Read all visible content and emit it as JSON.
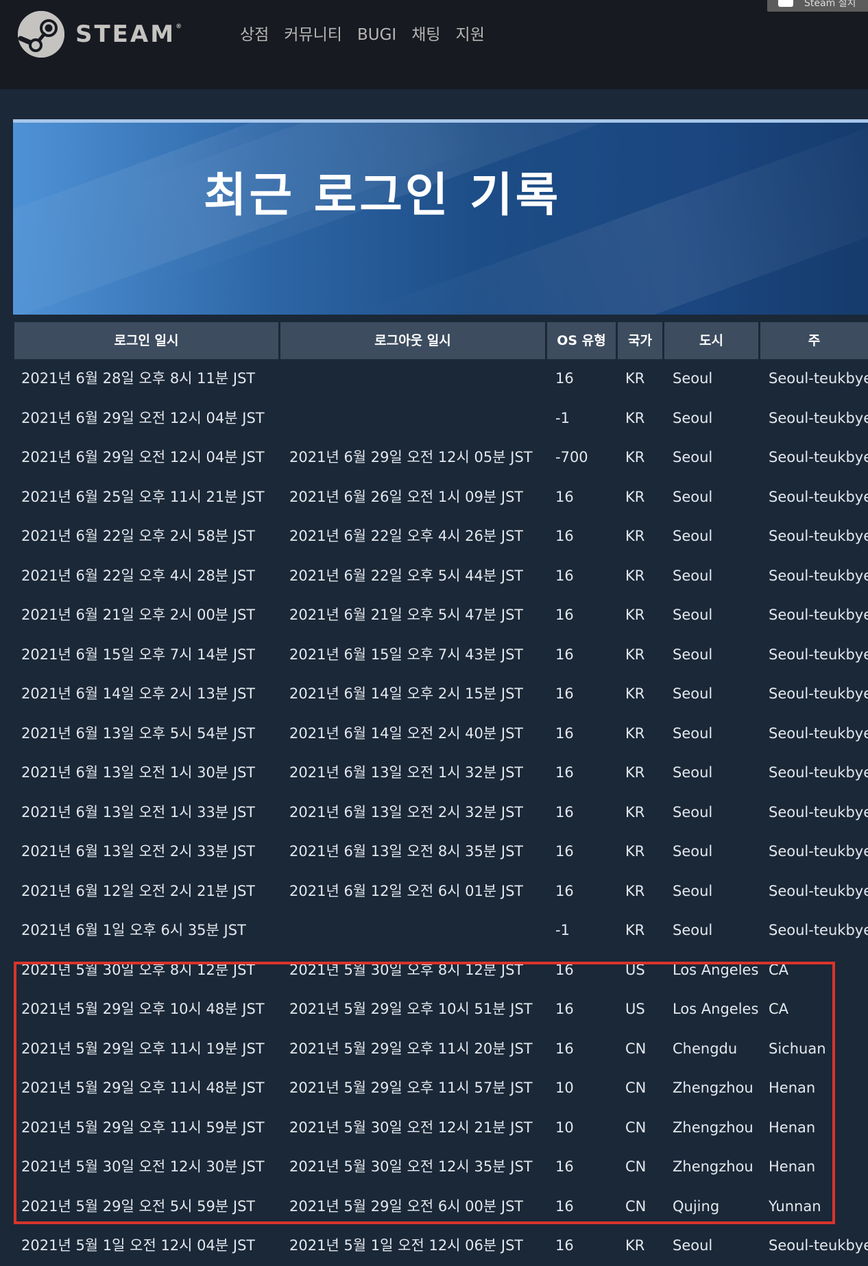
{
  "header": {
    "logo_text": "STEAM",
    "nav": [
      "상점",
      "커뮤니티",
      "BUGI",
      "채팅",
      "지원"
    ],
    "install_label": "Steam 설치"
  },
  "banner": {
    "title": "최근 로그인 기록"
  },
  "table": {
    "columns": [
      "로그인 일시",
      "로그아웃 일시",
      "OS 유형",
      "국가",
      "도시",
      "주"
    ],
    "rows": [
      [
        "2021년 6월 28일 오후 8시 11분 JST",
        "",
        "16",
        "KR",
        "Seoul",
        "Seoul-teukbyeolsi"
      ],
      [
        "2021년 6월 29일 오전 12시 04분 JST",
        "",
        "-1",
        "KR",
        "Seoul",
        "Seoul-teukbyeolsi"
      ],
      [
        "2021년 6월 29일 오전 12시 04분 JST",
        "2021년 6월 29일 오전 12시 05분 JST",
        "-700",
        "KR",
        "Seoul",
        "Seoul-teukbyeolsi"
      ],
      [
        "2021년 6월 25일 오후 11시 21분 JST",
        "2021년 6월 26일 오전 1시 09분 JST",
        "16",
        "KR",
        "Seoul",
        "Seoul-teukbyeolsi"
      ],
      [
        "2021년 6월 22일 오후 2시 58분 JST",
        "2021년 6월 22일 오후 4시 26분 JST",
        "16",
        "KR",
        "Seoul",
        "Seoul-teukbyeolsi"
      ],
      [
        "2021년 6월 22일 오후 4시 28분 JST",
        "2021년 6월 22일 오후 5시 44분 JST",
        "16",
        "KR",
        "Seoul",
        "Seoul-teukbyeolsi"
      ],
      [
        "2021년 6월 21일 오후 2시 00분 JST",
        "2021년 6월 21일 오후 5시 47분 JST",
        "16",
        "KR",
        "Seoul",
        "Seoul-teukbyeolsi"
      ],
      [
        "2021년 6월 15일 오후 7시 14분 JST",
        "2021년 6월 15일 오후 7시 43분 JST",
        "16",
        "KR",
        "Seoul",
        "Seoul-teukbyeolsi"
      ],
      [
        "2021년 6월 14일 오후 2시 13분 JST",
        "2021년 6월 14일 오후 2시 15분 JST",
        "16",
        "KR",
        "Seoul",
        "Seoul-teukbyeolsi"
      ],
      [
        "2021년 6월 13일 오후 5시 54분 JST",
        "2021년 6월 14일 오전 2시 40분 JST",
        "16",
        "KR",
        "Seoul",
        "Seoul-teukbyeolsi"
      ],
      [
        "2021년 6월 13일 오전 1시 30분 JST",
        "2021년 6월 13일 오전 1시 32분 JST",
        "16",
        "KR",
        "Seoul",
        "Seoul-teukbyeolsi"
      ],
      [
        "2021년 6월 13일 오전 1시 33분 JST",
        "2021년 6월 13일 오전 2시 32분 JST",
        "16",
        "KR",
        "Seoul",
        "Seoul-teukbyeolsi"
      ],
      [
        "2021년 6월 13일 오전 2시 33분 JST",
        "2021년 6월 13일 오전 8시 35분 JST",
        "16",
        "KR",
        "Seoul",
        "Seoul-teukbyeolsi"
      ],
      [
        "2021년 6월 12일 오전 2시 21분 JST",
        "2021년 6월 12일 오전 6시 01분 JST",
        "16",
        "KR",
        "Seoul",
        "Seoul-teukbyeolsi"
      ],
      [
        "2021년 6월 1일 오후 6시 35분 JST",
        "",
        "-1",
        "KR",
        "Seoul",
        "Seoul-teukbyeolsi"
      ],
      [
        "2021년 5월 30일 오후 8시 12분 JST",
        "2021년 5월 30일 오후 8시 12분 JST",
        "16",
        "US",
        "Los Angeles",
        "CA"
      ],
      [
        "2021년 5월 29일 오후 10시 48분 JST",
        "2021년 5월 29일 오후 10시 51분 JST",
        "16",
        "US",
        "Los Angeles",
        "CA"
      ],
      [
        "2021년 5월 29일 오후 11시 19분 JST",
        "2021년 5월 29일 오후 11시 20분 JST",
        "16",
        "CN",
        "Chengdu",
        "Sichuan"
      ],
      [
        "2021년 5월 29일 오후 11시 48분 JST",
        "2021년 5월 29일 오후 11시 57분 JST",
        "10",
        "CN",
        "Zhengzhou",
        "Henan"
      ],
      [
        "2021년 5월 29일 오후 11시 59분 JST",
        "2021년 5월 30일 오전 12시 21분 JST",
        "10",
        "CN",
        "Zhengzhou",
        "Henan"
      ],
      [
        "2021년 5월 30일 오전 12시 30분 JST",
        "2021년 5월 30일 오전 12시 35분 JST",
        "16",
        "CN",
        "Zhengzhou",
        "Henan"
      ],
      [
        "2021년 5월 29일 오전 5시 59분 JST",
        "2021년 5월 29일 오전 6시 00분 JST",
        "16",
        "CN",
        "Qujing",
        "Yunnan"
      ],
      [
        "2021년 5월 1일 오전 12시 04분 JST",
        "2021년 5월 1일 오전 12시 06분 JST",
        "16",
        "KR",
        "Seoul",
        "Seoul-teukbyeolsi"
      ]
    ]
  },
  "colors": {
    "background": "#1b2838",
    "topbar": "#171a21",
    "header_cell": "#3d4c5f",
    "highlight_box": "#d9342b"
  }
}
